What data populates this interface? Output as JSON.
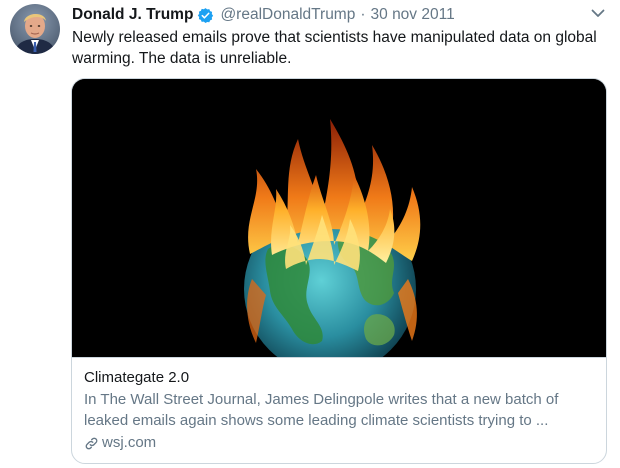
{
  "tweet": {
    "author_name": "Donald J. Trump",
    "handle": "@realDonaldTrump",
    "separator": "·",
    "date": "30 nov 2011",
    "text": "Newly released emails prove that scientists have manipulated data on global warming. The data is unreliable.",
    "verified_icon": "verified-badge-icon",
    "menu_icon": "chevron-down-icon"
  },
  "card": {
    "image_icon": "burning-globe-image",
    "title": "Climategate 2.0",
    "description": "In The Wall Street Journal, James Delingpole writes that a new batch of leaked emails again shows some leading climate scientists trying to ...",
    "source_icon": "link-icon",
    "source": "wsj.com"
  },
  "colors": {
    "text_primary": "#14171a",
    "text_secondary": "#657786",
    "verified_blue": "#1da1f2",
    "border": "#ccd6dd"
  }
}
